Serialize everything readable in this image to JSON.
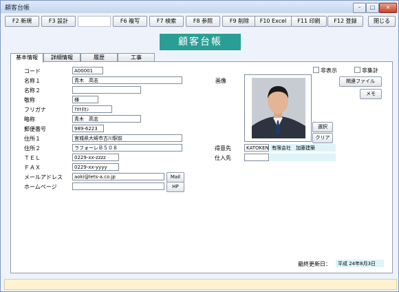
{
  "window": {
    "title": "顧客台帳",
    "minimize": "–",
    "maximize": "□",
    "close": "×"
  },
  "toolbar": {
    "f2": "F2 新規",
    "f3": "F3 設計",
    "f6": "F6 複写",
    "f7": "F7 検索",
    "f8": "F8 参照",
    "f9": "F9 削除",
    "f10": "F10 Excel",
    "f11": "F11 印刷",
    "f12": "F12 登録",
    "close": "閉じる"
  },
  "banner": "顧客台帳",
  "tabs": [
    "基本情報",
    "詳細情報",
    "履歴",
    "工事"
  ],
  "labels": {
    "code": "コード",
    "name1": "名称１",
    "name2": "名称２",
    "honorific": "敬称",
    "furigana": "フリガナ",
    "short": "略称",
    "zip": "郵便番号",
    "addr1": "住所１",
    "addr2": "住所２",
    "tel": "ＴＥＬ",
    "fax": "ＦＡＸ",
    "mail": "メールアドレス",
    "home": "ホームページ",
    "image": "画像",
    "customer": "得意先",
    "supplier": "仕入先",
    "hidden": "非表示",
    "nototal": "非集計",
    "updated": "最終更新日："
  },
  "values": {
    "code": "A00001",
    "name1": "青木　高志",
    "name2": "",
    "honorific": "様",
    "furigana": "ｱｵｷﾀｶｼ",
    "short": "青木　高志",
    "zip": "989-6223",
    "addr1": "宮城県大崎市古川駅前",
    "addr2": "ラフォーレＢ５０８",
    "tel": "0229-xx-zzzz",
    "fax": "0229-xx-yyyy",
    "mail": "aoki@lets-a.co.jp",
    "home": "",
    "customer_code": "KATOKENT",
    "customer_name": "有限会社　加藤建築",
    "supplier_code": "",
    "supplier_name": "",
    "updated": "平成 24年8月3日"
  },
  "buttons": {
    "mail": "Mail",
    "hp": "HP",
    "related": "関連ファイル",
    "memo": "メモ",
    "select": "選択",
    "clear": "クリア"
  },
  "colors": {
    "banner": "#2a9e95",
    "statusbar": "#fff3cf",
    "cyan_field": "#def4f8"
  }
}
